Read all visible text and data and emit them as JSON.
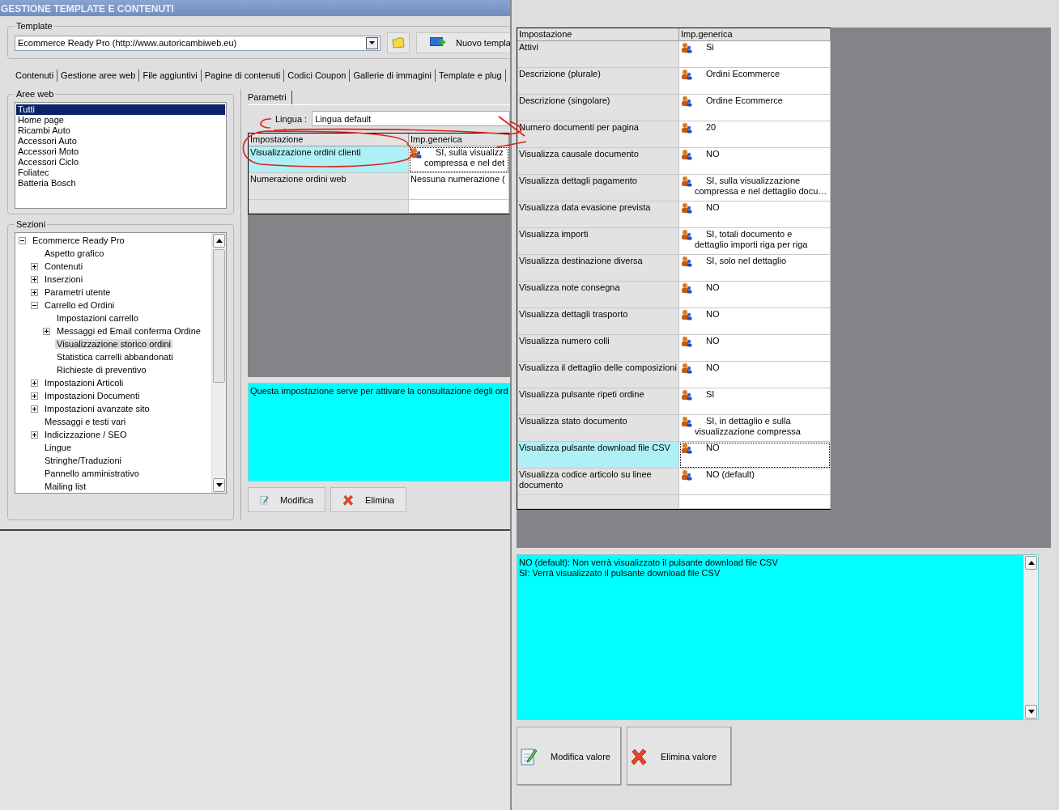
{
  "window": {
    "title": "GESTIONE TEMPLATE E CONTENUTI"
  },
  "template": {
    "label": "Template",
    "value": "Ecommerce Ready Pro (http://www.autoricambiweb.eu)",
    "new_button": "Nuovo templa"
  },
  "tabs": [
    "Contenuti",
    "Gestione aree web",
    "File aggiuntivi",
    "Pagine di contenuti",
    "Codici Coupon",
    "Gallerie di immagini",
    "Template e plug"
  ],
  "web_areas": {
    "label": "Aree web",
    "items": [
      {
        "label": "Tutti",
        "selected": true
      },
      {
        "label": "Home page",
        "selected": false
      },
      {
        "label": "Ricambi Auto",
        "selected": false
      },
      {
        "label": "Accessori Auto",
        "selected": false
      },
      {
        "label": "Accessori Moto",
        "selected": false
      },
      {
        "label": "Accessori Ciclo",
        "selected": false
      },
      {
        "label": "Foliatec",
        "selected": false
      },
      {
        "label": "Batteria Bosch",
        "selected": false
      }
    ]
  },
  "sections": {
    "label": "Sezioni",
    "tree": [
      {
        "label": "Ecommerce Ready Pro",
        "kind": "node",
        "expanded": true,
        "selected": false,
        "children": [
          {
            "label": "Aspetto grafico",
            "kind": "leaf",
            "selected": false
          },
          {
            "label": "Contenuti",
            "kind": "node",
            "expanded": false,
            "selected": false
          },
          {
            "label": "Inserzioni",
            "kind": "node",
            "expanded": false,
            "selected": false
          },
          {
            "label": "Parametri utente",
            "kind": "node",
            "expanded": false,
            "selected": false
          },
          {
            "label": "Carrello ed Ordini",
            "kind": "node",
            "expanded": true,
            "selected": false,
            "children": [
              {
                "label": "Impostazioni carrello",
                "kind": "leaf",
                "selected": false
              },
              {
                "label": "Messaggi ed Email conferma Ordine",
                "kind": "node",
                "expanded": false,
                "selected": false
              },
              {
                "label": "Visualizzazione storico ordini",
                "kind": "leaf",
                "selected": true
              },
              {
                "label": "Statistica carrelli abbandonati",
                "kind": "leaf",
                "selected": false
              },
              {
                "label": "Richieste di preventivo",
                "kind": "leaf",
                "selected": false
              }
            ]
          },
          {
            "label": "Impostazioni Articoli",
            "kind": "node",
            "expanded": false,
            "selected": false
          },
          {
            "label": "Impostazioni Documenti",
            "kind": "node",
            "expanded": false,
            "selected": false
          },
          {
            "label": "Impostazioni avanzate sito",
            "kind": "node",
            "expanded": false,
            "selected": false
          },
          {
            "label": "Messaggi e testi vari",
            "kind": "leaf",
            "selected": false
          },
          {
            "label": "Indicizzazione / SEO",
            "kind": "node",
            "expanded": false,
            "selected": false
          },
          {
            "label": "Lingue",
            "kind": "leaf",
            "selected": false
          },
          {
            "label": "Stringhe/Traduzioni",
            "kind": "leaf",
            "selected": false
          },
          {
            "label": "Pannello amministrativo",
            "kind": "leaf",
            "selected": false
          },
          {
            "label": "Mailing list",
            "kind": "leaf",
            "selected": false
          }
        ]
      }
    ]
  },
  "parameters": {
    "tab": "Parametri",
    "language_label": "Lingua :",
    "language": "Lingua default",
    "columns": [
      "Impostazione",
      "Imp.generica"
    ],
    "rows": [
      {
        "setting": "Visualizzazione ordini clienti",
        "value": [
          "SI, sulla visualizz",
          "compressa e nel det"
        ],
        "has_icon": true,
        "selected": true
      },
      {
        "setting": "Numerazione ordini web",
        "value": [
          "Nessuna numerazione ("
        ],
        "has_icon": false,
        "selected": false
      }
    ],
    "description": "Questa impostazione serve per attivare la consultazione degli ord",
    "buttons": [
      "Modifica",
      "Elimina"
    ]
  },
  "detail": {
    "columns": [
      "Impostazione",
      "Imp.generica"
    ],
    "rows": [
      {
        "setting": "Attivi",
        "value": [
          "Si"
        ],
        "has_icon": true,
        "selected": false
      },
      {
        "setting": "Descrizione (plurale)",
        "value": [
          "Ordini Ecommerce"
        ],
        "has_icon": true,
        "selected": false
      },
      {
        "setting": "Descrizione (singolare)",
        "value": [
          "Ordine Ecommerce"
        ],
        "has_icon": true,
        "selected": false
      },
      {
        "setting": "Numero documenti per pagina",
        "value": [
          "20"
        ],
        "has_icon": true,
        "selected": false
      },
      {
        "setting": "Visualizza causale documento",
        "value": [
          "NO"
        ],
        "has_icon": true,
        "selected": false
      },
      {
        "setting": "Visualizza dettagli pagamento",
        "value": [
          "SI, sulla visualizzazione",
          "compressa e nel dettaglio docu…"
        ],
        "has_icon": true,
        "selected": false
      },
      {
        "setting": "Visualizza data evasione prevista",
        "value": [
          "NO"
        ],
        "has_icon": true,
        "selected": false
      },
      {
        "setting": "Visualizza importi",
        "value": [
          "SI, totali documento e",
          "dettaglio importi riga per riga"
        ],
        "has_icon": true,
        "selected": false
      },
      {
        "setting": "Visualizza destinazione diversa",
        "value": [
          "SI, solo nel dettaglio"
        ],
        "has_icon": true,
        "selected": false
      },
      {
        "setting": "Visualizza note consegna",
        "value": [
          "NO"
        ],
        "has_icon": true,
        "selected": false
      },
      {
        "setting": "Visualizza dettagli trasporto",
        "value": [
          "NO"
        ],
        "has_icon": true,
        "selected": false
      },
      {
        "setting": "Visualizza numero colli",
        "value": [
          "NO"
        ],
        "has_icon": true,
        "selected": false
      },
      {
        "setting": "Visualizza il dettaglio delle composizioni",
        "value": [
          "NO"
        ],
        "has_icon": true,
        "selected": false
      },
      {
        "setting": "Visualizza pulsante ripeti ordine",
        "value": [
          "SI"
        ],
        "has_icon": true,
        "selected": false
      },
      {
        "setting": "Visualizza stato documento",
        "value": [
          "SI, in dettaglio e sulla",
          "visualizzazione compressa"
        ],
        "has_icon": true,
        "selected": false
      },
      {
        "setting": "Visualizza pulsante download file CSV",
        "value": [
          "NO"
        ],
        "has_icon": true,
        "selected": true
      },
      {
        "setting": "Visualizza codice articolo su linee documento",
        "value": [
          "NO (default)"
        ],
        "has_icon": true,
        "selected": false
      }
    ],
    "description": [
      "NO (default): Non verrà visualizzato il pulsante download file CSV",
      "SI: Verrà visualizzato il pulsante download file CSV"
    ],
    "buttons": [
      "Modifica valore",
      "Elimina valore"
    ]
  }
}
